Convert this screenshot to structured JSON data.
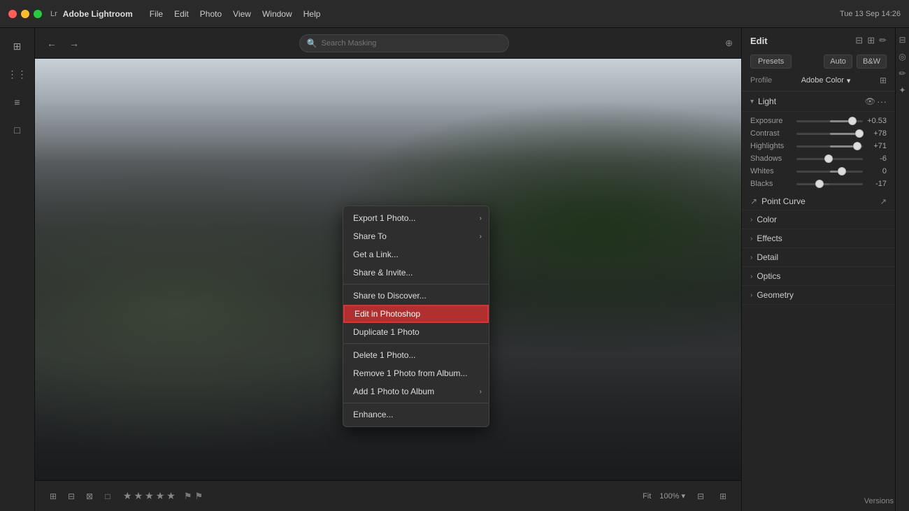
{
  "app": {
    "name": "Adobe Lightroom",
    "icon": "Lr"
  },
  "titlebar": {
    "menu_items": [
      "File",
      "Edit",
      "Photo",
      "View",
      "Window",
      "Help"
    ],
    "search_placeholder": "Search Masking",
    "time": "Tue 13 Sep 14:26"
  },
  "context_menu": {
    "items": [
      {
        "label": "Export 1 Photo...",
        "has_arrow": true
      },
      {
        "label": "Share To",
        "has_arrow": true
      },
      {
        "label": "Get a Link..."
      },
      {
        "label": "Share & Invite..."
      },
      {
        "label": "Share to Discover..."
      },
      {
        "label": "Edit in Photoshop",
        "highlighted": true
      },
      {
        "label": "Duplicate 1 Photo"
      },
      {
        "label": "Delete 1 Photo..."
      },
      {
        "label": "Remove 1 Photo from Album..."
      },
      {
        "label": "Add 1 Photo to Album",
        "has_arrow": true
      },
      {
        "label": "Enhance..."
      }
    ]
  },
  "right_panel": {
    "title": "Edit",
    "profile_label": "Profile",
    "profile_value": "Adobe Color",
    "preset_label": "Presets",
    "auto_label": "Auto",
    "bw_label": "B&W",
    "sections": {
      "light": {
        "label": "Light",
        "sliders": [
          {
            "label": "Exposure",
            "value": "+0.53",
            "pct": 78
          },
          {
            "label": "Contrast",
            "value": "+78",
            "pct": 88
          },
          {
            "label": "Highlights",
            "value": "+71",
            "pct": 85
          },
          {
            "label": "Shadows",
            "value": "-6",
            "pct": 42
          },
          {
            "label": "Whites",
            "value": "0",
            "pct": 62
          },
          {
            "label": "Blacks",
            "value": "-17",
            "pct": 28
          }
        ]
      },
      "point_curve": {
        "label": "Point Curve",
        "value": "↗"
      },
      "color": {
        "label": "Color"
      },
      "effects": {
        "label": "Effects"
      },
      "detail": {
        "label": "Detail"
      },
      "optics": {
        "label": "Optics"
      },
      "geometry": {
        "label": "Geometry"
      },
      "curve": {
        "label": "Curve"
      }
    }
  },
  "filmstrip": {
    "zoom_label": "Fit",
    "zoom_value": "100%",
    "versions_label": "Versions"
  },
  "icons": {
    "search": "🔍",
    "filter": "⊕",
    "arrow_left": "←",
    "arrow_right": "→",
    "arrow_right_small": "›",
    "chevron_down": "▾",
    "chevron_right": "›",
    "star": "★",
    "star_empty": "☆",
    "flag": "⚑"
  }
}
